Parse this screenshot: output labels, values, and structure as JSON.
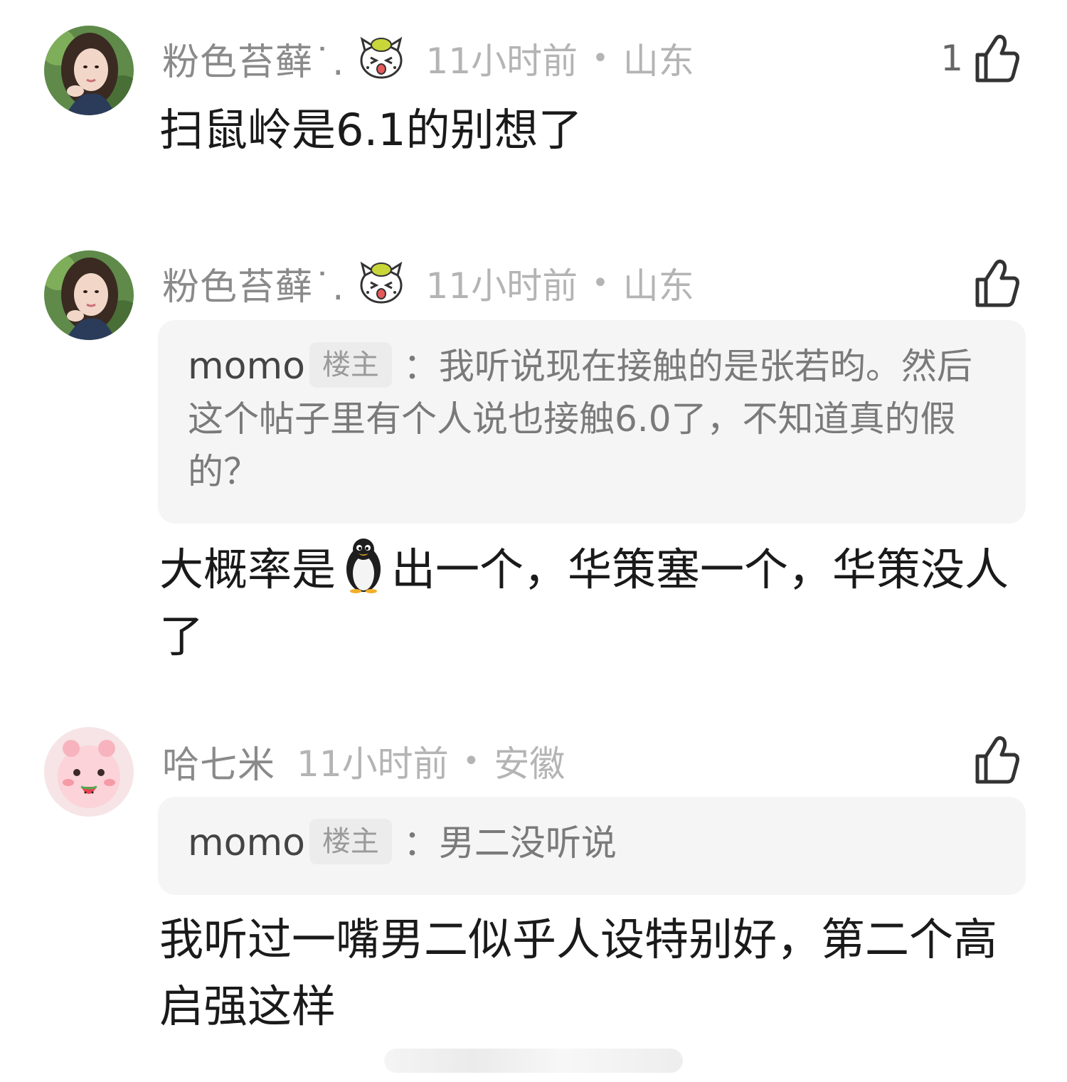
{
  "comments": [
    {
      "username": "粉色苔藓˙.",
      "time": "11小时前",
      "separator": "•",
      "location": "山东",
      "like_count": "1",
      "body": "扫鼠岭是6.1的别想了"
    },
    {
      "username": "粉色苔藓˙.",
      "time": "11小时前",
      "separator": "•",
      "location": "山东",
      "like_count": "",
      "quote": {
        "user": "momo",
        "tag": "楼主",
        "text": "：我听说现在接触的是张若昀。然后这个帖子里有个人说也接触6.0了，不知道真的假的？"
      },
      "body_before": "大概率是",
      "body_after": "出一个，华策塞一个，华策没人了"
    },
    {
      "username": "哈七米",
      "time": "11小时前",
      "separator": "•",
      "location": "安徽",
      "like_count": "",
      "quote": {
        "user": "momo",
        "tag": "楼主",
        "text": "：男二没听说"
      },
      "body": "我听过一嘴男二似乎人设特别好，第二个高启强这样"
    }
  ],
  "icons": {
    "like": "thumbs-up-icon",
    "badge": "cartoon-cat-badge-icon",
    "emoji": "penguin-emoji-icon"
  },
  "colors": {
    "username": "#8a8a8a",
    "meta": "#b4b4b4",
    "body": "#1a1a1a",
    "quote_bg": "#f5f5f5"
  }
}
